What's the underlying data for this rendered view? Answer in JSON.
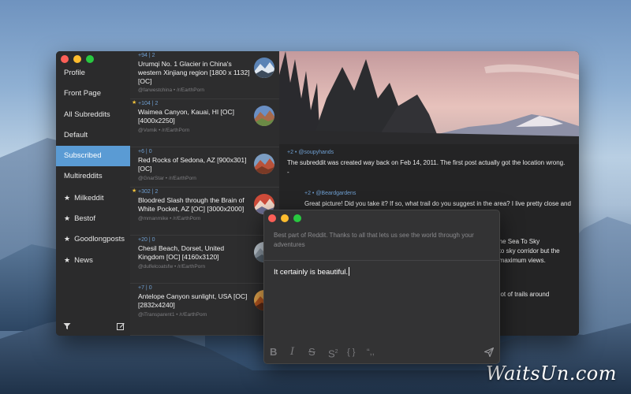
{
  "sidebar": {
    "items": [
      {
        "label": "Profile",
        "star": false,
        "active": false
      },
      {
        "label": "Front Page",
        "star": false,
        "active": false
      },
      {
        "label": "All Subreddits",
        "star": false,
        "active": false
      },
      {
        "label": "Default",
        "star": false,
        "active": false
      },
      {
        "label": "Subscribed",
        "star": false,
        "active": true
      },
      {
        "label": "Multireddits",
        "star": false,
        "active": false
      },
      {
        "label": "Milkeddit",
        "star": true,
        "active": false
      },
      {
        "label": "Bestof",
        "star": true,
        "active": false
      },
      {
        "label": "Goodlongposts",
        "star": true,
        "active": false
      },
      {
        "label": "News",
        "star": true,
        "active": false
      }
    ],
    "star_glyph": "★",
    "footer_icons": [
      "filter-icon",
      "compose-icon"
    ]
  },
  "posts": [
    {
      "meta": "+94 | 2",
      "title": "Urumqi No. 1 Glacier in China's western Xinjiang region [1800 x 1132] [OC]",
      "sub": "@farwestchina • /r/EarthPorn",
      "fav": false
    },
    {
      "meta": "+104 | 2",
      "title": "Waimea Canyon, Kauai, HI [OC] [4000x2250]",
      "sub": "@Vomik • /r/EarthPorn",
      "fav": true
    },
    {
      "meta": "+6 | 0",
      "title": "Red Rocks of Sedona, AZ [900x301] [OC]",
      "sub": "@GnarStar • /r/EarthPorn",
      "fav": false
    },
    {
      "meta": "+302 | 2",
      "title": "Bloodred Slash through the Brain of White Pocket, AZ [OC] [3000x2000]",
      "sub": "@mmanmike • /r/EarthPorn",
      "fav": true
    },
    {
      "meta": "+20 | 0",
      "title": "Chesil Beach, Dorset, United Kingdom [OC] [4160x3120]",
      "sub": "@dulfelcoatsfw • /r/EarthPorn",
      "fav": false
    },
    {
      "meta": "+7 | 0",
      "title": "Antelope Canyon sunlight, USA [OC] [2832x4240]",
      "sub": "@iTransparent1 • /r/EarthPorn",
      "fav": false
    }
  ],
  "detail": {
    "comments": [
      {
        "meta": "+2 • @soupyhands",
        "body": "The subreddit was created way back on Feb 14, 2011. The first post actually got the location wrong.",
        "extra": "-"
      },
      {
        "meta": "+2 • @Beardgardens",
        "body": "Great picture! Did you take it? If so, what trail do you suggest in the area? I live pretty close and"
      }
    ],
    "clipped_lines": [
      "f the Sea To Sky",
      "a to sky corridor but the",
      "d maximum views.",
      "a lot of trails around"
    ]
  },
  "reply": {
    "quote": "Best part of Reddit. Thanks to all that lets us see the world through your adventures",
    "input_text": "It certainly is beautiful.",
    "toolbar": {
      "bold": "B",
      "italic": "I",
      "strike": "S",
      "superscript": "S",
      "superscript_mark": "2",
      "code": "{ }",
      "quote": "“,,"
    }
  },
  "watermark": "WaitsUn.com"
}
